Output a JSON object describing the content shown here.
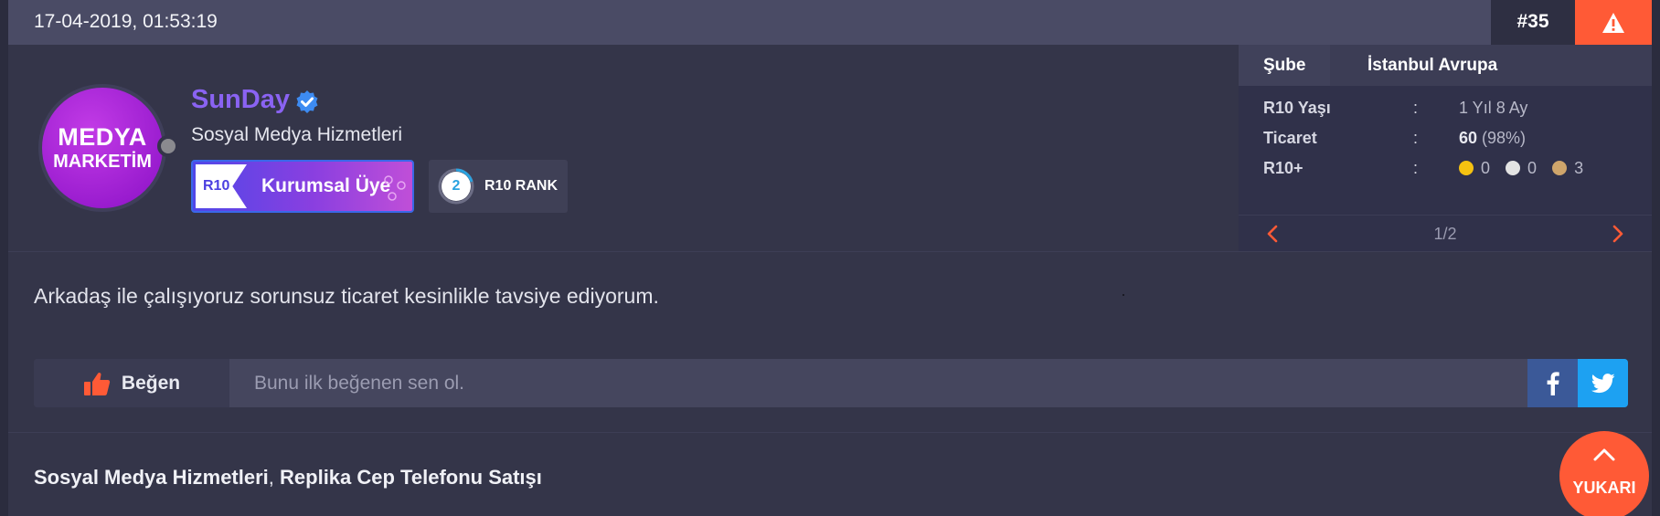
{
  "post": {
    "date": "17-04-2019, 01:53:19",
    "number": "#35"
  },
  "user": {
    "avatar_line1": "MEDYA",
    "avatar_line2": "MARKETİM",
    "name": "SunDay",
    "title": "Sosyal Medya Hizmetleri",
    "badge_tag": "R10",
    "badge_label": "Kurumsal Üye",
    "rank_number": "2",
    "rank_label": "R10 RANK"
  },
  "info": {
    "tab_label": "Şube",
    "tab_value": "İstanbul Avrupa",
    "rows": {
      "age": {
        "key": "R10 Yaşı",
        "sep": ":",
        "value": "1 Yıl 8 Ay"
      },
      "trade": {
        "key": "Ticaret",
        "sep": ":",
        "value_bold": "60",
        "value_rest": " (98%)"
      },
      "plus": {
        "key": "R10+",
        "sep": ":",
        "gold": "0",
        "silver": "0",
        "bronze": "3"
      }
    },
    "pager": "1/2"
  },
  "message": "Arkadaş ile çalışıyoruz sorunsuz ticaret kesinlikle tavsiye ediyorum.",
  "likes": {
    "button_label": "Beğen",
    "placeholder": "Bunu ilk beğenen sen ol."
  },
  "categories": {
    "first": "Sosyal Medya Hizmetleri",
    "separator": ", ",
    "second": "Replika Cep Telefonu Satışı"
  },
  "scroll_top_label": "YUKARI",
  "colors": {
    "accent": "#ff5a36",
    "username": "#8a63f2",
    "facebook": "#3b5998",
    "twitter": "#1da1f2"
  }
}
